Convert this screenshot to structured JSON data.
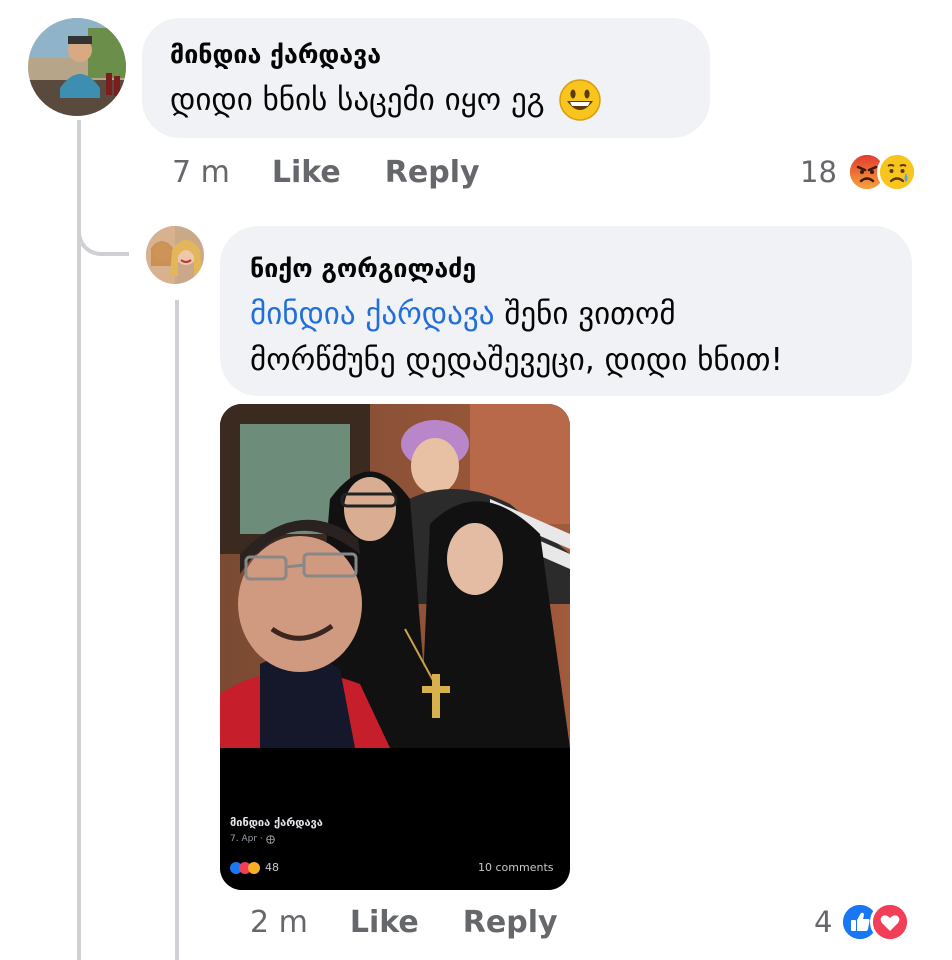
{
  "comment1": {
    "author": "მინდია ქარდავა",
    "text": "დიდი ხნის საცემი იყო ეგ",
    "time": "7 m",
    "like_label": "Like",
    "reply_label": "Reply",
    "reaction_count": "18",
    "reactions": [
      "angry-icon",
      "sad-icon"
    ]
  },
  "comment2": {
    "author": "ნიქო გორგილაძე",
    "mention": "მინდია ქარდავა",
    "text_line1": "შენი ვითომ",
    "text_line2": "მორწმუნე დედაშევეცი, დიდი ხნით!",
    "time": "2 m",
    "like_label": "Like",
    "reply_label": "Reply",
    "reaction_count": "4",
    "reactions": [
      "like-icon",
      "love-icon"
    ]
  },
  "shared_post": {
    "author": "მინდია ქარდავა",
    "date": "7. Apr ·",
    "reaction_count": "48",
    "comments": "10 comments"
  },
  "colors": {
    "bubble": "#f0f2f5",
    "mention": "#216fdb",
    "meta_text": "#65676b",
    "like_blue": "#1877f2",
    "love_red": "#f33e58"
  }
}
